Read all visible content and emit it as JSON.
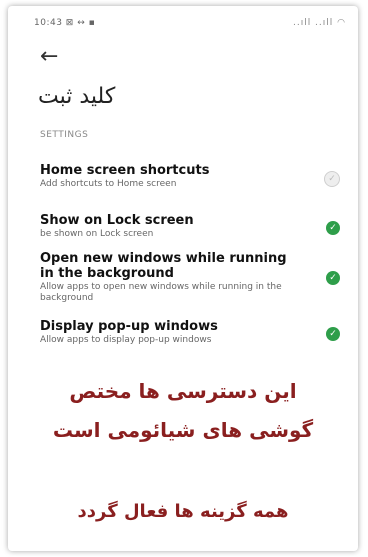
{
  "status_bar": {
    "time": "10:43 ⊠ ↔ ▪",
    "right": "..ıll ..ıll ◠"
  },
  "header": {
    "back_icon": "arrow-left-icon",
    "title": "کلید ثبت"
  },
  "section": {
    "label": "SETTINGS"
  },
  "settings": [
    {
      "title": "Home screen shortcuts",
      "subtitle": "Add shortcuts to Home screen",
      "enabled": false
    },
    {
      "title": "Show on Lock screen",
      "subtitle": "be shown on Lock screen",
      "enabled": true
    },
    {
      "title": "Open new windows while running in the background",
      "subtitle": "Allow apps to open new windows while running in the background",
      "enabled": true
    },
    {
      "title": "Display pop-up windows",
      "subtitle": "Allow apps to display pop-up windows",
      "enabled": true
    }
  ],
  "overlay": {
    "line1": "این دسترسی ها مختص",
    "line2": "گوشی های شیائومی است",
    "line3": "همه گزینه ها فعال گردد",
    "color": "#8a1f1f"
  }
}
